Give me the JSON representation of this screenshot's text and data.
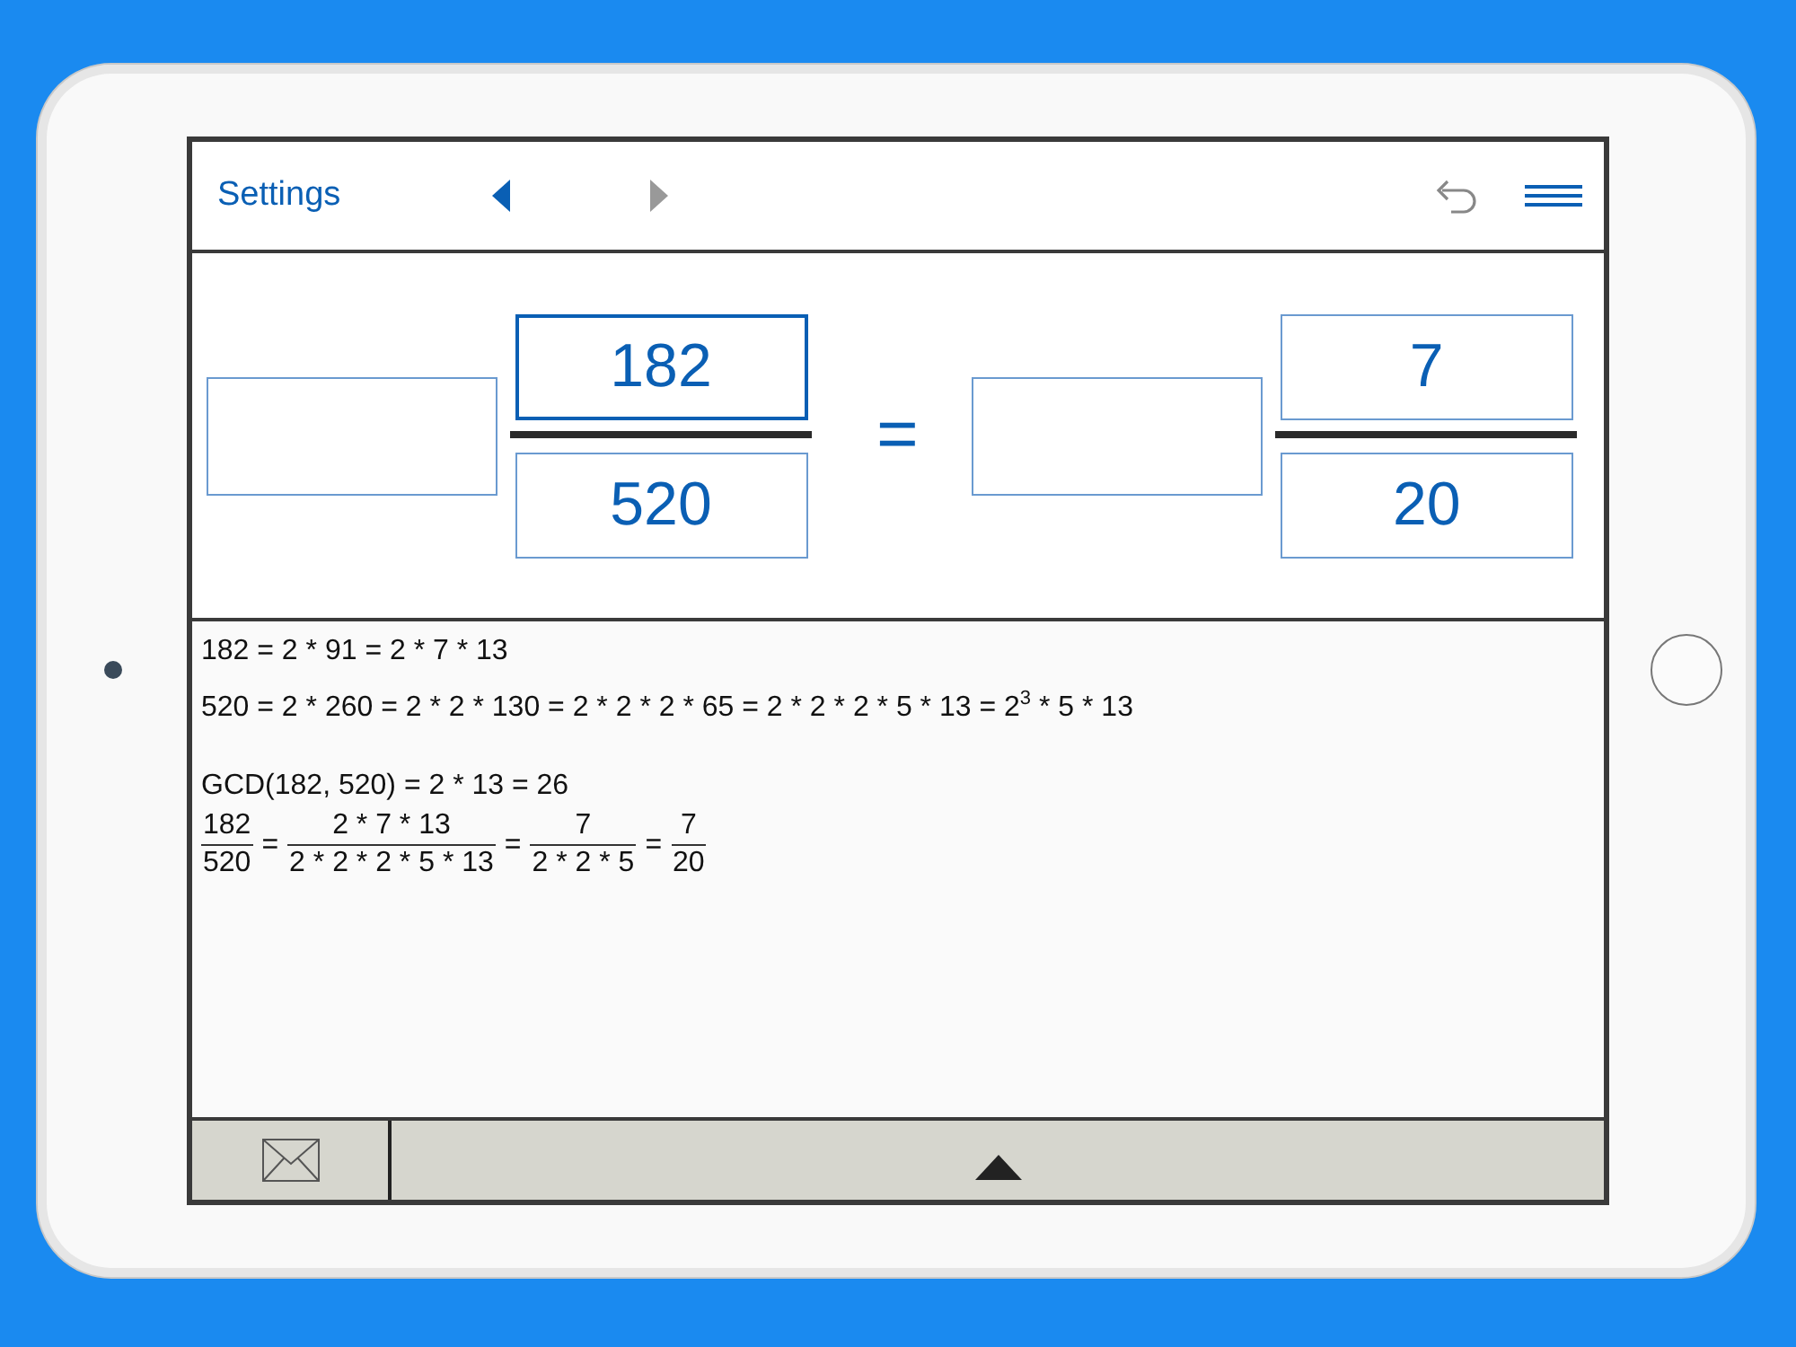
{
  "toolbar": {
    "settings": "Settings",
    "back_enabled": true,
    "forward_enabled": false,
    "undo_enabled": false
  },
  "equation": {
    "left": {
      "whole": {
        "selected": false
      },
      "numerator": {
        "value": "182",
        "selected": true
      },
      "denominator": {
        "value": "520",
        "selected": false
      }
    },
    "equals": "=",
    "right": {
      "whole": {
        "selected": false
      },
      "numerator": {
        "value": "7",
        "selected": false
      },
      "denominator": {
        "value": "20",
        "selected": false
      }
    }
  },
  "solution": [
    {
      "kind": "text",
      "text": "182 = 2 * 91 = 2 * 7 * 13"
    },
    {
      "kind": "text",
      "text": "520 = 2 * 260 = 2 * 2 * 130 = 2 * 2 * 2 * 65 = 2 * 2 * 2 * 5 * 13 = 2$^{3}$ * 5 * 13"
    },
    {
      "kind": "blank"
    },
    {
      "kind": "text",
      "text": "GCD(182, 520) = 2 * 13 = 26"
    },
    {
      "kind": "fractions",
      "items": [
        {
          "kind": "fraction",
          "numerator": "182",
          "denominator": "520"
        },
        {
          "kind": "symbol",
          "text": "="
        },
        {
          "kind": "fraction",
          "numerator": "2 * 7 * 13",
          "denominator": "2 * 2 * 2 * 5 * 13"
        },
        {
          "kind": "symbol",
          "text": "="
        },
        {
          "kind": "fraction",
          "numerator": "7",
          "denominator": "2 * 2 * 5"
        },
        {
          "kind": "symbol",
          "text": "="
        },
        {
          "kind": "fraction",
          "numerator": "7",
          "denominator": "20"
        }
      ]
    }
  ]
}
